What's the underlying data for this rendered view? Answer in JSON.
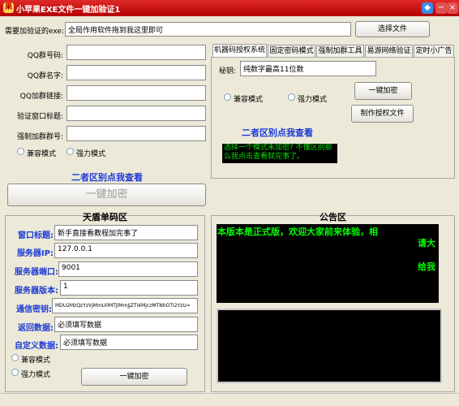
{
  "window": {
    "title": "小苹果EXE文件一键加验证1"
  },
  "top": {
    "exe_label": "需要加验证的exe:",
    "exe_value": "全局作用软件拖到我这里即可",
    "select_file": "选择文件"
  },
  "left_form": {
    "qq_group_number": "QQ群号码:",
    "qq_group_name": "QQ群名字:",
    "qq_group_link": "QQ加群链接:",
    "window_title": "验证窗口标题:",
    "force_group": "强制加群群号:",
    "compat_mode": "兼容模式",
    "strong_mode": "强力模式",
    "diff_link": "二者区别点我查看",
    "one_key": "一键加密"
  },
  "tabs": {
    "items": [
      "机器码授权系统",
      "固定密码模式",
      "强制加群工具",
      "易游网络验证",
      "定时小广告"
    ],
    "secret_label": "秘钥:",
    "secret_value": "纯数字最高11位数",
    "one_key": "一键加密",
    "make_file": "制作授权文件",
    "compat_mode": "兼容模式",
    "strong_mode": "强力模式",
    "diff_link": "二者区别点我查看",
    "green_text": "选择一个模式未加密? 不懂区别那么我点击查看就完事了。"
  },
  "tiandun": {
    "title": "天盾单码区",
    "window_title_label": "窗口标题:",
    "window_title_value": "新手直接看教程加完事了",
    "ip_label": "服务器IP:",
    "ip_value": "127.0.0.1",
    "port_label": "服务器端口:",
    "port_value": "9001",
    "version_label": "服务器版本:",
    "version_value": "1",
    "key_label": "通信密钥:",
    "key_value": "MDU2MzQzYzVjMmU0MTJlMmJjZTI4MjczMTNhOTI2YzU=",
    "return_label": "返回数据:",
    "return_value": "必须填写数据",
    "custom_label": "自定义数据:",
    "custom_value": "必须填写数据",
    "compat_mode": "兼容模式",
    "strong_mode": "强力模式",
    "one_key": "一键加密"
  },
  "announcement": {
    "title": "公告区",
    "line1": "本版本是正式版，欢迎大家前来体验，相",
    "line2": "请大",
    "line3": "给我"
  },
  "colors": {
    "title_red": "#c80000",
    "announce_green": "#00ff00",
    "link_blue": "#1c3ad6"
  }
}
